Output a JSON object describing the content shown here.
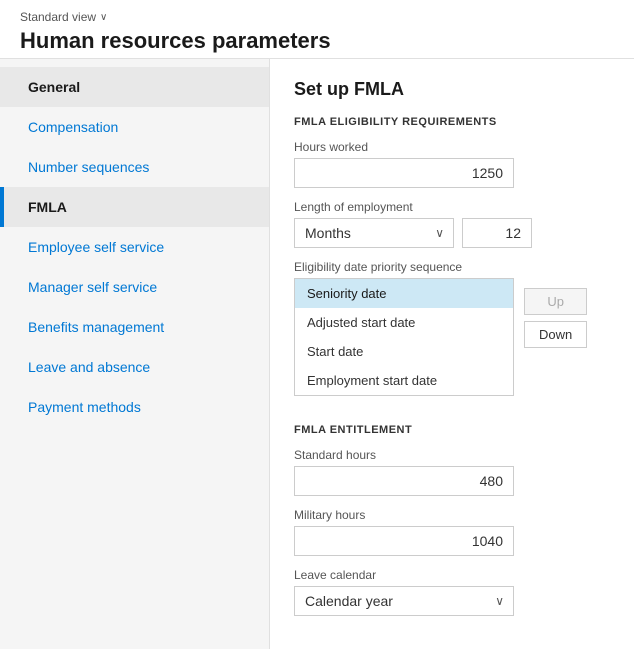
{
  "header": {
    "standard_view_label": "Standard view",
    "chevron": "∨",
    "page_title": "Human resources parameters"
  },
  "sidebar": {
    "items": [
      {
        "id": "general",
        "label": "General",
        "active": true,
        "highlighted": true
      },
      {
        "id": "compensation",
        "label": "Compensation",
        "active": false
      },
      {
        "id": "number-sequences",
        "label": "Number sequences",
        "active": false
      },
      {
        "id": "fmla",
        "label": "FMLA",
        "active": false,
        "accent": true
      },
      {
        "id": "employee-self-service",
        "label": "Employee self service",
        "active": false
      },
      {
        "id": "manager-self-service",
        "label": "Manager self service",
        "active": false
      },
      {
        "id": "benefits-management",
        "label": "Benefits management",
        "active": false
      },
      {
        "id": "leave-and-absence",
        "label": "Leave and absence",
        "active": false
      },
      {
        "id": "payment-methods",
        "label": "Payment methods",
        "active": false
      }
    ]
  },
  "content": {
    "section_title": "Set up FMLA",
    "eligibility": {
      "section_label": "FMLA ELIGIBILITY REQUIREMENTS",
      "hours_worked_label": "Hours worked",
      "hours_worked_value": "1250",
      "length_of_employment_label": "Length of employment",
      "length_dropdown_value": "Months",
      "length_number_value": "12",
      "priority_label": "Eligibility date priority sequence",
      "priority_items": [
        {
          "id": "seniority-date",
          "label": "Seniority date",
          "selected": true
        },
        {
          "id": "adjusted-start-date",
          "label": "Adjusted start date",
          "selected": false
        },
        {
          "id": "start-date",
          "label": "Start date",
          "selected": false
        },
        {
          "id": "employment-start-date",
          "label": "Employment start date",
          "selected": false
        }
      ],
      "up_button_label": "Up",
      "down_button_label": "Down"
    },
    "entitlement": {
      "section_label": "FMLA ENTITLEMENT",
      "standard_hours_label": "Standard hours",
      "standard_hours_value": "480",
      "military_hours_label": "Military hours",
      "military_hours_value": "1040",
      "leave_calendar_label": "Leave calendar",
      "leave_calendar_value": "Calendar year",
      "leave_calendar_chevron": "∨"
    }
  }
}
